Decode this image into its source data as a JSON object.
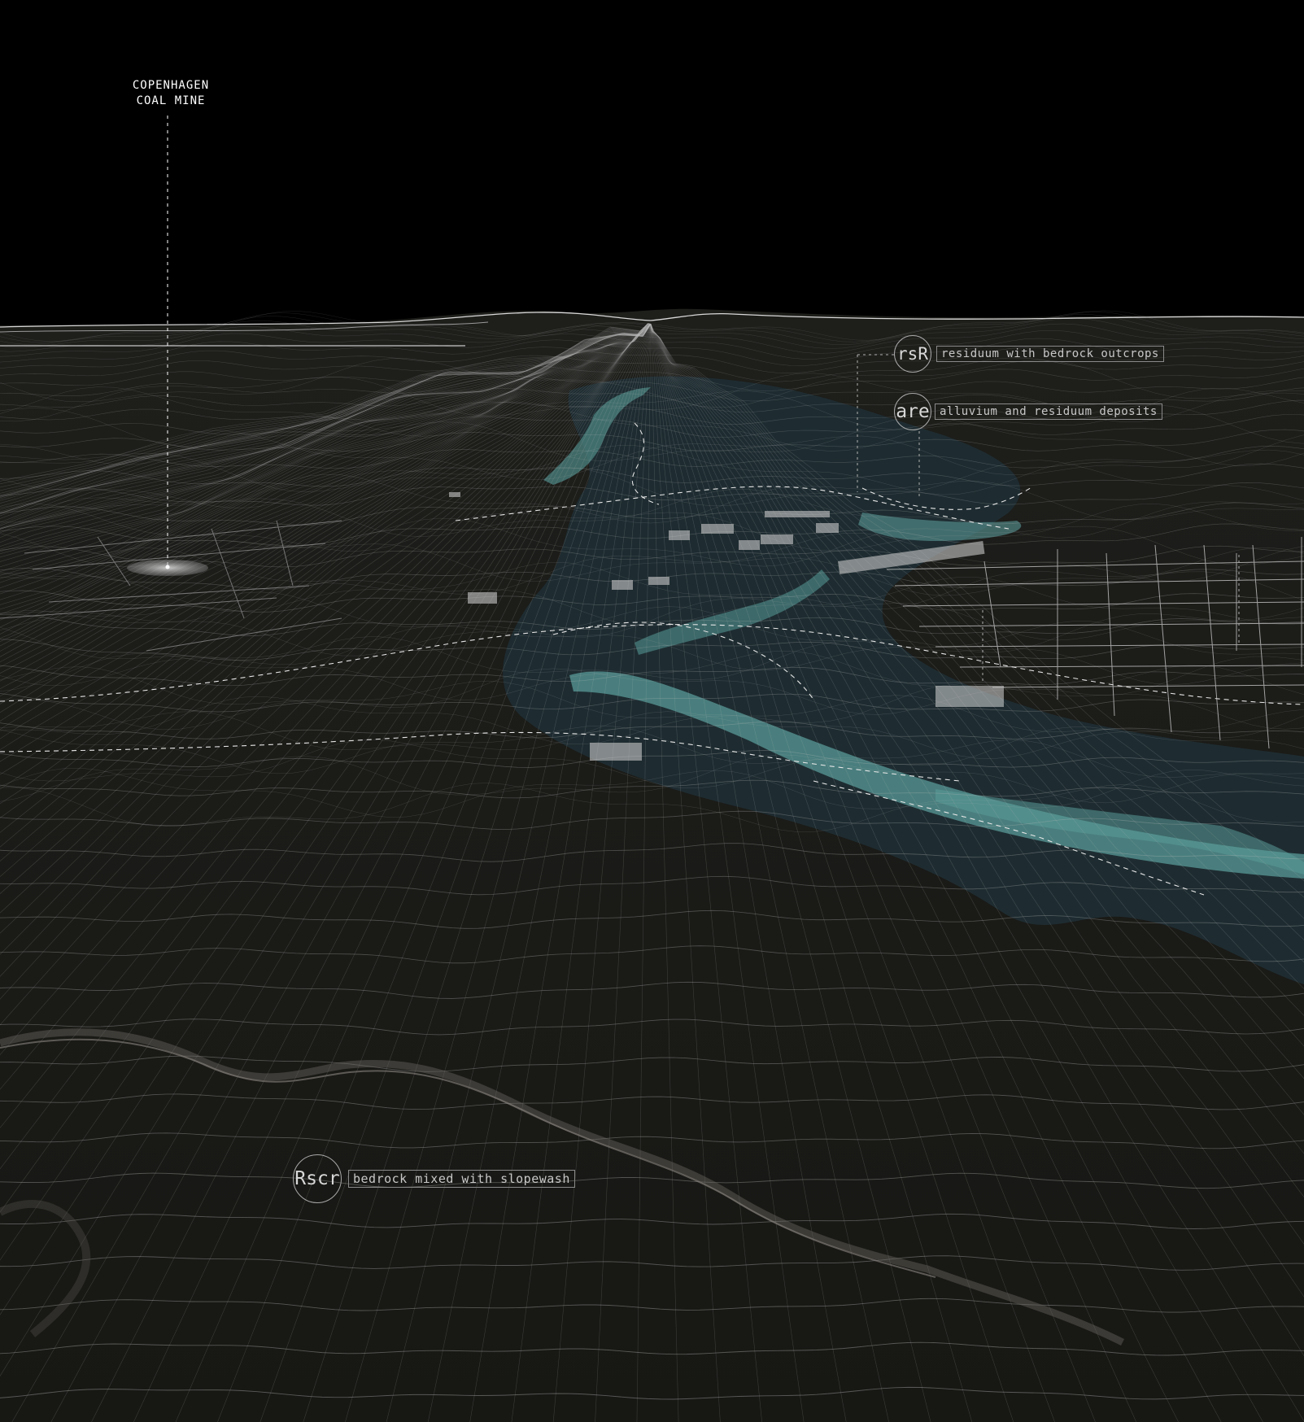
{
  "site_label": {
    "line1": "COPENHAGEN",
    "line2": "COAL MINE"
  },
  "legend": [
    {
      "code": "rsR",
      "description": "residuum with bedrock outcrops"
    },
    {
      "code": "are",
      "description": "alluvium and residuum deposits"
    },
    {
      "code": "Rscr",
      "description": "bedrock mixed with slopewash"
    }
  ],
  "colors": {
    "background": "#000000",
    "ground": "#1a1a17",
    "mesh": "#bcbcbc",
    "water": "#5a9a98",
    "water_dark": "#23323a",
    "label": "#e8e8e8"
  }
}
